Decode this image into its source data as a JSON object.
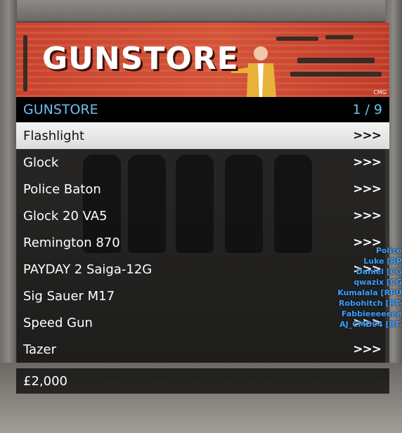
{
  "banner": {
    "title": "GUNSTORE",
    "badge": "CMG"
  },
  "menu": {
    "header": "GUNSTORE",
    "page_counter": "1 / 9",
    "items": [
      {
        "label": "Flashlight",
        "arrow": ">>>",
        "selected": true
      },
      {
        "label": "Glock",
        "arrow": ">>>"
      },
      {
        "label": "Police Baton",
        "arrow": ">>>"
      },
      {
        "label": "Glock 20 VA5",
        "arrow": ">>>"
      },
      {
        "label": "Remington 870",
        "arrow": ">>>"
      },
      {
        "label": "PAYDAY 2 Saiga-12G",
        "arrow": ">>>"
      },
      {
        "label": "Sig Sauer M17",
        "arrow": ""
      },
      {
        "label": "Speed Gun",
        "arrow": ">>>"
      },
      {
        "label": "Tazer",
        "arrow": ">>>"
      }
    ],
    "price": "£2,000"
  },
  "players": [
    "Police",
    "Luke [RP",
    "Daniel [CG",
    "qwazix [CG",
    "Kumalala [RPU",
    "Robohitch [RT-",
    "Fabbieeeeeee",
    "AJ_CMD94 [RT-"
  ],
  "colors": {
    "accent": "#6ec1f0",
    "banner": "#d45439",
    "player_text": "#3aa0ff"
  }
}
